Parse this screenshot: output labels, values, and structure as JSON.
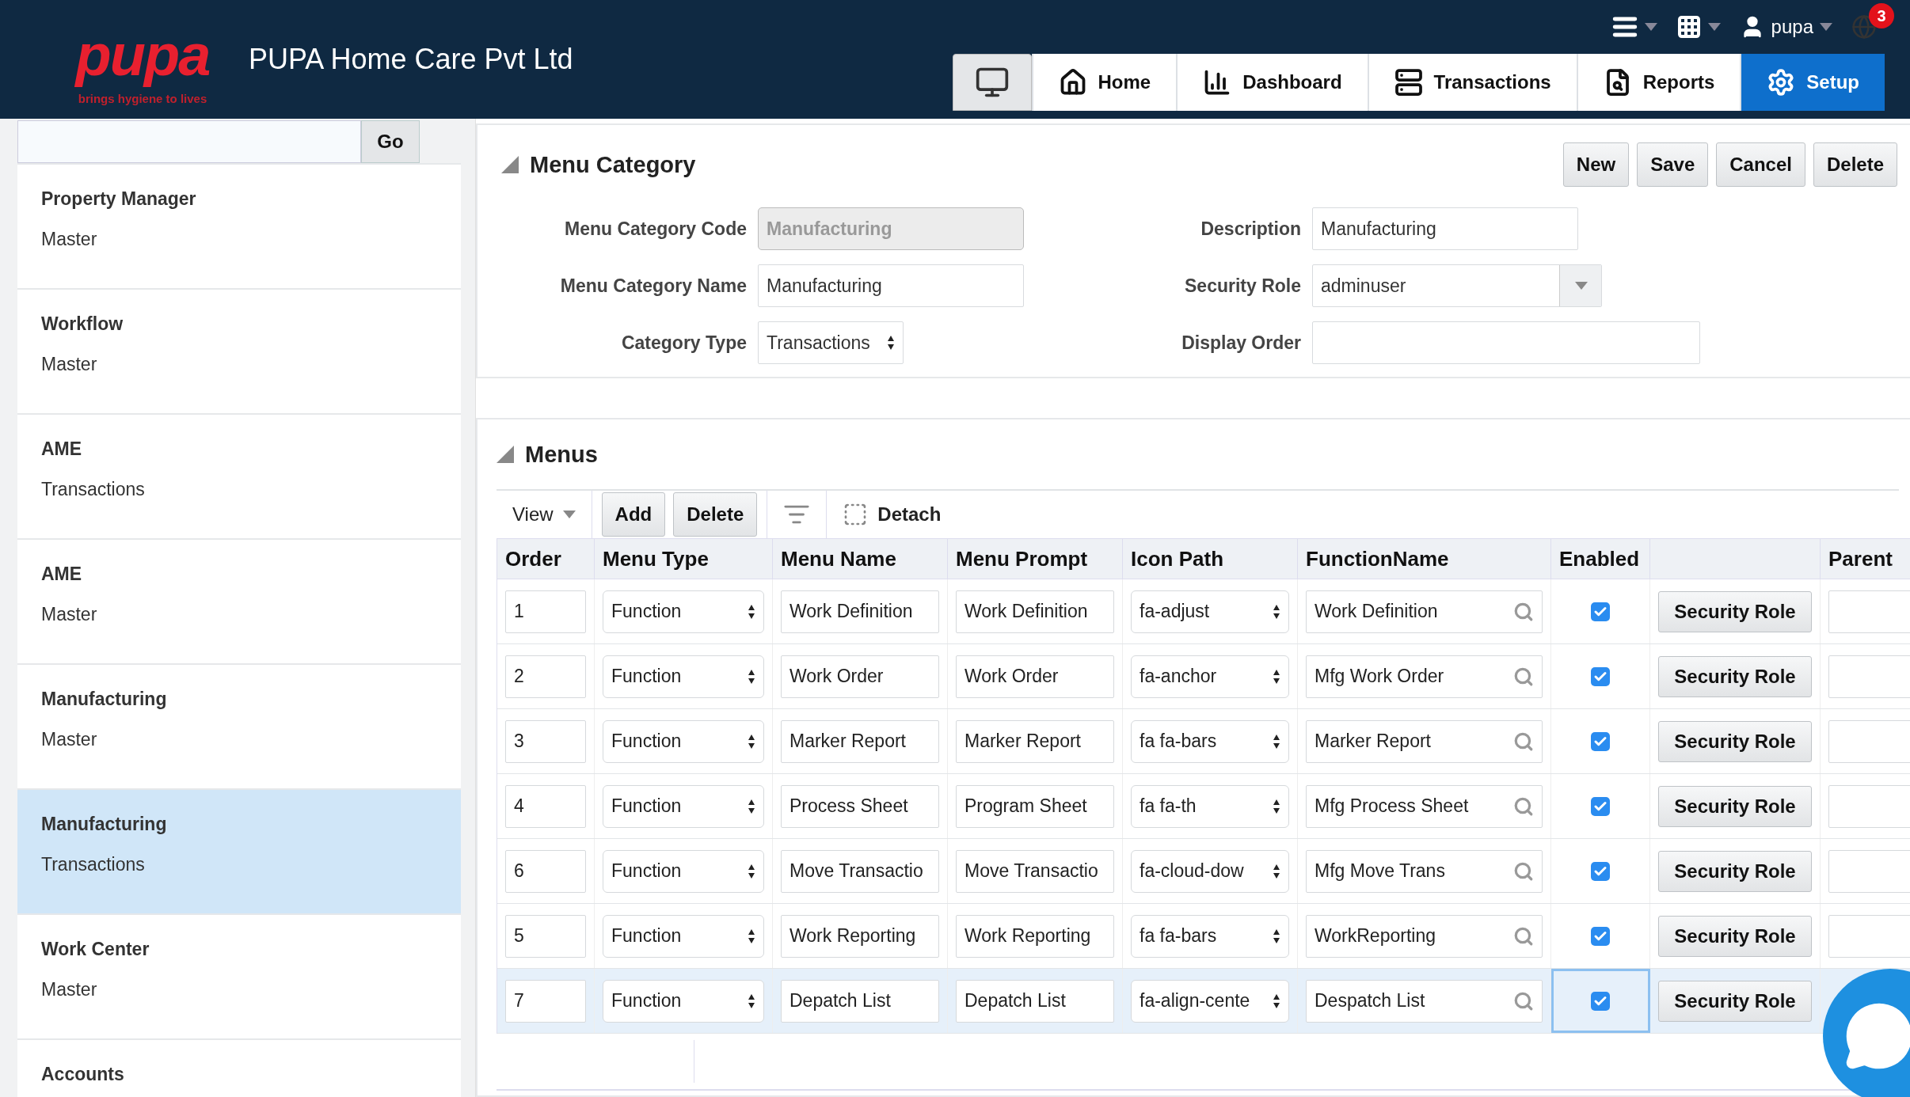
{
  "header": {
    "logo": {
      "wordmark": "pupa",
      "tagline": "brings hygiene to lives"
    },
    "company": "PUPA Home Care Pvt Ltd",
    "user": "pupa",
    "notification_count": "3",
    "nav_tabs": [
      {
        "label": "Home",
        "selected": false
      },
      {
        "label": "Dashboard",
        "selected": false
      },
      {
        "label": "Transactions",
        "selected": false
      },
      {
        "label": "Reports",
        "selected": false
      },
      {
        "label": "Setup",
        "selected": true
      }
    ]
  },
  "sidebar": {
    "search_button": "Go",
    "items": [
      {
        "title": "Property Manager",
        "subtitle": "Master",
        "selected": false
      },
      {
        "title": "Workflow",
        "subtitle": "Master",
        "selected": false
      },
      {
        "title": "AME",
        "subtitle": "Transactions",
        "selected": false
      },
      {
        "title": "AME",
        "subtitle": "Master",
        "selected": false
      },
      {
        "title": "Manufacturing",
        "subtitle": "Master",
        "selected": false
      },
      {
        "title": "Manufacturing",
        "subtitle": "Transactions",
        "selected": true
      },
      {
        "title": "Work Center",
        "subtitle": "Master",
        "selected": false
      },
      {
        "title": "Accounts",
        "selected": false
      }
    ]
  },
  "menu_category": {
    "title": "Menu Category",
    "buttons": [
      "New",
      "Save",
      "Cancel",
      "Delete"
    ],
    "fields": [
      {
        "label": "Menu Category Code",
        "value": "Manufacturing",
        "kind": "text",
        "disabled": true
      },
      {
        "label": "Menu Category Name",
        "value": "Manufacturing",
        "kind": "text",
        "disabled": false
      },
      {
        "label": "Category Type",
        "value": "Transactions",
        "kind": "select",
        "disabled": false
      },
      {
        "label": "Description",
        "value": "Manufacturing",
        "kind": "text",
        "disabled": false
      },
      {
        "label": "Security Role",
        "value": "adminuser",
        "kind": "combo",
        "disabled": false
      },
      {
        "label": "Display Order",
        "kind": "wide",
        "disabled": false
      }
    ]
  },
  "menus": {
    "title": "Menus",
    "toolbar": {
      "view": "View",
      "buttons": [
        "Add",
        "Delete"
      ],
      "detach": "Detach"
    },
    "columns": [
      "Order",
      "Menu Type",
      "Menu Name",
      "Menu Prompt",
      "Icon Path",
      "FunctionName",
      "Enabled",
      "Parent"
    ],
    "rows": [
      {
        "order": "1",
        "menu_type": "Function",
        "menu_name": "Work Definition",
        "menu_prompt": "Work Definition",
        "icon_path": "fa-adjust",
        "function_name": "Work Definition",
        "enabled": true,
        "action": "Security Role",
        "selected": false
      },
      {
        "order": "2",
        "menu_type": "Function",
        "menu_name": "Work Order",
        "menu_prompt": "Work Order",
        "icon_path": "fa-anchor",
        "function_name": "Mfg Work Order",
        "enabled": true,
        "action": "Security Role",
        "selected": false
      },
      {
        "order": "3",
        "menu_type": "Function",
        "menu_name": "Marker Report",
        "menu_prompt": "Marker Report",
        "icon_path": "fa fa-bars",
        "function_name": "Marker Report",
        "enabled": true,
        "action": "Security Role",
        "selected": false
      },
      {
        "order": "4",
        "menu_type": "Function",
        "menu_name": "Process Sheet",
        "menu_prompt": "Program Sheet",
        "icon_path": "fa fa-th",
        "function_name": "Mfg Process Sheet",
        "enabled": true,
        "action": "Security Role",
        "selected": false
      },
      {
        "order": "6",
        "menu_type": "Function",
        "menu_name": "Move Transactio",
        "menu_prompt": "Move Transactio",
        "icon_path": "fa-cloud-dow",
        "function_name": "Mfg Move Trans",
        "enabled": true,
        "action": "Security Role",
        "selected": false
      },
      {
        "order": "5",
        "menu_type": "Function",
        "menu_name": "Work Reporting",
        "menu_prompt": "Work Reporting",
        "icon_path": "fa fa-bars",
        "function_name": "WorkReporting",
        "enabled": true,
        "action": "Security Role",
        "selected": false
      },
      {
        "order": "7",
        "menu_type": "Function",
        "menu_name": "Depatch List",
        "menu_prompt": "Depatch List",
        "icon_path": "fa-align-cente",
        "function_name": "Despatch List",
        "enabled": true,
        "action": "Security Role",
        "selected": true
      }
    ]
  }
}
